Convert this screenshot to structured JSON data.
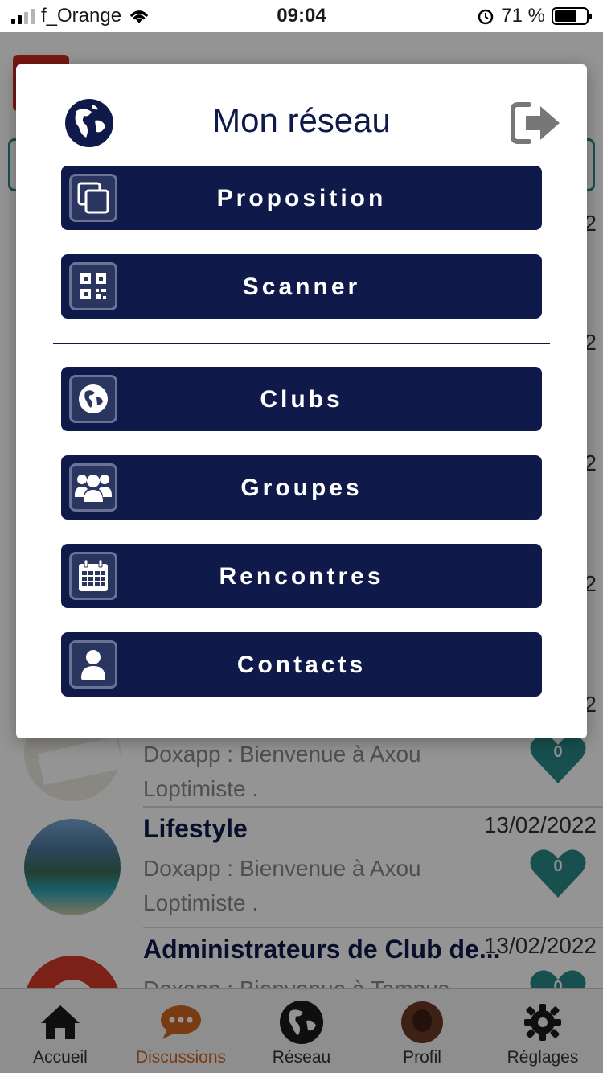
{
  "status_bar": {
    "carrier": "f_Orange",
    "time": "09:04",
    "battery": "71 %"
  },
  "modal": {
    "title": "Mon réseau",
    "buttons": [
      {
        "label": "Proposition",
        "icon": "copy-icon"
      },
      {
        "label": "Scanner",
        "icon": "qr-code-icon"
      },
      {
        "label": "Clubs",
        "icon": "globe-icon"
      },
      {
        "label": "Groupes",
        "icon": "users-icon"
      },
      {
        "label": "Rencontres",
        "icon": "calendar-icon"
      },
      {
        "label": "Contacts",
        "icon": "user-icon"
      }
    ]
  },
  "background": {
    "chats": [
      {
        "title": "",
        "date": "",
        "msg": "Doxapp : Bienvenue à Axou Loptimiste .",
        "likes": "0"
      },
      {
        "title": "Lifestyle",
        "date": "13/02/2022",
        "msg": "Doxapp : Bienvenue à Axou Loptimiste .",
        "likes": "0"
      },
      {
        "title": "Administrateurs de Club de...",
        "date": "13/02/2022",
        "msg": "Doxapp : Bienvenue à Tempus",
        "likes": "0"
      }
    ],
    "date_peeks": [
      "2",
      "2",
      "2",
      "2",
      "2"
    ]
  },
  "tab_bar": {
    "tabs": [
      {
        "label": "Accueil",
        "icon": "home-icon"
      },
      {
        "label": "Discussions",
        "icon": "chat-icon"
      },
      {
        "label": "Réseau",
        "icon": "globe-icon"
      },
      {
        "label": "Profil",
        "icon": "avatar"
      },
      {
        "label": "Réglages",
        "icon": "gear-icon"
      }
    ],
    "active": "Discussions"
  },
  "colors": {
    "navy": "#0f1a4a",
    "teal": "#2a8a8a",
    "accent": "#d0661f"
  }
}
